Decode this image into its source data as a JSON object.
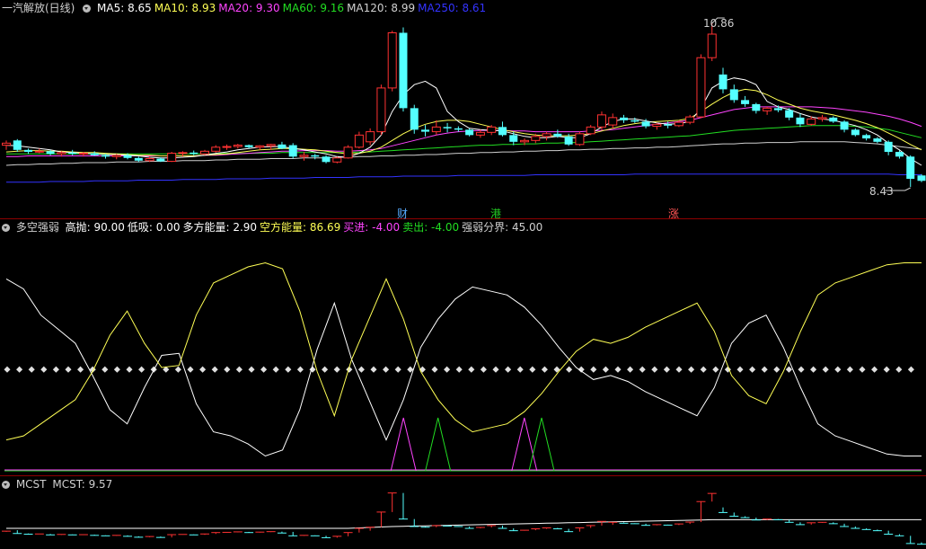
{
  "main_panel": {
    "stock_title": "一汽解放(日线)",
    "ma": [
      {
        "label": "MA5: 8.65",
        "color": "#ffffff"
      },
      {
        "label": "MA10: 8.93",
        "color": "#ffff55"
      },
      {
        "label": "MA20: 9.30",
        "color": "#ff44ff"
      },
      {
        "label": "MA60: 9.16",
        "color": "#22dd22"
      },
      {
        "label": "MA120: 8.99",
        "color": "#d0d0d0"
      },
      {
        "label": "MA250: 8.61",
        "color": "#3333ff"
      }
    ],
    "high_label": "10.86",
    "low_label": "8.43",
    "event_tags": [
      {
        "text": "财",
        "color": "#55aaff"
      },
      {
        "text": "港",
        "color": "#22cc22"
      },
      {
        "text": "涨",
        "color": "#ff5555"
      }
    ]
  },
  "indicator_panel": {
    "name": "多空强弱",
    "items": [
      {
        "label": "高抛: 90.00",
        "color": "#ffffff"
      },
      {
        "label": "低吸: 0.00",
        "color": "#ffffff"
      },
      {
        "label": "多方能量: 2.90",
        "color": "#ffffff"
      },
      {
        "label": "空方能量: 86.69",
        "color": "#ffff55"
      },
      {
        "label": "买进: -4.00",
        "color": "#ff44ff"
      },
      {
        "label": "卖出: -4.00",
        "color": "#22dd22"
      },
      {
        "label": "强弱分界: 45.00",
        "color": "#d0d0d0"
      }
    ]
  },
  "mcst_panel": {
    "name": "MCST",
    "value_label": "MCST: 9.57"
  },
  "chart_data": {
    "type": "candlestick",
    "price_range": [
      8.43,
      10.86
    ],
    "ohlc": [
      [
        9.05,
        9.12,
        8.98,
        9.08
      ],
      [
        9.12,
        9.14,
        8.95,
        8.98
      ],
      [
        8.98,
        9.0,
        8.92,
        8.95
      ],
      [
        8.95,
        9.0,
        8.93,
        8.96
      ],
      [
        8.96,
        8.98,
        8.9,
        8.92
      ],
      [
        8.92,
        8.96,
        8.88,
        8.94
      ],
      [
        8.94,
        8.98,
        8.9,
        8.92
      ],
      [
        8.92,
        8.95,
        8.88,
        8.93
      ],
      [
        8.93,
        8.96,
        8.89,
        8.9
      ],
      [
        8.9,
        8.92,
        8.85,
        8.88
      ],
      [
        8.88,
        8.92,
        8.84,
        8.9
      ],
      [
        8.9,
        8.93,
        8.84,
        8.86
      ],
      [
        8.86,
        8.88,
        8.8,
        8.82
      ],
      [
        8.82,
        8.88,
        8.8,
        8.85
      ],
      [
        8.85,
        8.87,
        8.8,
        8.81
      ],
      [
        8.81,
        8.95,
        8.8,
        8.93
      ],
      [
        8.93,
        8.96,
        8.88,
        8.94
      ],
      [
        8.94,
        8.97,
        8.9,
        8.92
      ],
      [
        8.92,
        8.98,
        8.9,
        8.96
      ],
      [
        8.96,
        9.05,
        8.94,
        9.02
      ],
      [
        9.02,
        9.06,
        8.98,
        9.03
      ],
      [
        9.03,
        9.07,
        9.0,
        9.05
      ],
      [
        9.05,
        9.06,
        9.0,
        9.02
      ],
      [
        9.02,
        9.05,
        8.98,
        9.04
      ],
      [
        9.04,
        9.07,
        8.98,
        9.06
      ],
      [
        9.06,
        9.1,
        8.99,
        9.0
      ],
      [
        9.05,
        9.08,
        8.85,
        8.88
      ],
      [
        8.88,
        8.95,
        8.82,
        8.9
      ],
      [
        8.9,
        8.92,
        8.84,
        8.88
      ],
      [
        8.88,
        8.9,
        8.78,
        8.8
      ],
      [
        8.8,
        8.88,
        8.78,
        8.86
      ],
      [
        8.86,
        9.05,
        8.85,
        9.02
      ],
      [
        9.02,
        9.25,
        9.0,
        9.2
      ],
      [
        9.1,
        9.3,
        9.05,
        9.25
      ],
      [
        9.25,
        9.95,
        9.2,
        9.9
      ],
      [
        9.9,
        10.75,
        9.85,
        10.72
      ],
      [
        10.72,
        10.8,
        9.55,
        9.6
      ],
      [
        9.6,
        9.65,
        9.22,
        9.28
      ],
      [
        9.28,
        9.35,
        9.18,
        9.25
      ],
      [
        9.25,
        9.42,
        9.2,
        9.32
      ],
      [
        9.32,
        9.38,
        9.24,
        9.3
      ],
      [
        9.3,
        9.33,
        9.25,
        9.28
      ],
      [
        9.28,
        9.3,
        9.18,
        9.2
      ],
      [
        9.2,
        9.28,
        9.16,
        9.24
      ],
      [
        9.24,
        9.35,
        9.2,
        9.32
      ],
      [
        9.32,
        9.4,
        9.18,
        9.2
      ],
      [
        9.2,
        9.25,
        9.05,
        9.1
      ],
      [
        9.1,
        9.15,
        9.05,
        9.12
      ],
      [
        9.12,
        9.22,
        9.08,
        9.18
      ],
      [
        9.18,
        9.25,
        9.12,
        9.22
      ],
      [
        9.22,
        9.28,
        9.16,
        9.18
      ],
      [
        9.18,
        9.22,
        9.04,
        9.06
      ],
      [
        9.06,
        9.25,
        9.04,
        9.22
      ],
      [
        9.22,
        9.35,
        9.2,
        9.32
      ],
      [
        9.32,
        9.55,
        9.28,
        9.5
      ],
      [
        9.35,
        9.52,
        9.3,
        9.46
      ],
      [
        9.46,
        9.5,
        9.38,
        9.42
      ],
      [
        9.42,
        9.46,
        9.38,
        9.4
      ],
      [
        9.4,
        9.44,
        9.3,
        9.33
      ],
      [
        9.33,
        9.38,
        9.28,
        9.36
      ],
      [
        9.36,
        9.4,
        9.3,
        9.34
      ],
      [
        9.34,
        9.42,
        9.32,
        9.39
      ],
      [
        9.39,
        9.5,
        9.36,
        9.47
      ],
      [
        9.47,
        10.4,
        9.45,
        10.35
      ],
      [
        10.35,
        10.86,
        10.3,
        10.7
      ],
      [
        10.1,
        10.2,
        9.82,
        9.88
      ],
      [
        9.88,
        9.95,
        9.68,
        9.72
      ],
      [
        9.72,
        9.78,
        9.62,
        9.66
      ],
      [
        9.66,
        9.68,
        9.52,
        9.56
      ],
      [
        9.56,
        9.62,
        9.5,
        9.6
      ],
      [
        9.6,
        9.64,
        9.54,
        9.57
      ],
      [
        9.57,
        9.6,
        9.42,
        9.46
      ],
      [
        9.46,
        9.52,
        9.32,
        9.36
      ],
      [
        9.36,
        9.48,
        9.34,
        9.44
      ],
      [
        9.44,
        9.5,
        9.4,
        9.46
      ],
      [
        9.46,
        9.48,
        9.38,
        9.4
      ],
      [
        9.4,
        9.42,
        9.24,
        9.28
      ],
      [
        9.28,
        9.3,
        9.18,
        9.2
      ],
      [
        9.2,
        9.22,
        9.12,
        9.15
      ],
      [
        9.15,
        9.17,
        9.08,
        9.1
      ],
      [
        9.1,
        9.12,
        8.9,
        8.95
      ],
      [
        8.95,
        8.97,
        8.85,
        8.88
      ],
      [
        8.88,
        8.9,
        8.43,
        8.55
      ],
      [
        8.6,
        8.62,
        8.5,
        8.52
      ]
    ],
    "ma5": [
      9.05,
      9.04,
      9.02,
      9.0,
      8.98,
      8.95,
      8.94,
      8.93,
      8.92,
      8.91,
      8.91,
      8.9,
      8.89,
      8.87,
      8.86,
      8.86,
      8.87,
      8.88,
      8.9,
      8.93,
      8.95,
      8.98,
      9.0,
      9.02,
      9.03,
      9.03,
      9.0,
      8.98,
      8.95,
      8.92,
      8.88,
      8.87,
      8.93,
      9.02,
      9.2,
      9.55,
      9.8,
      9.95,
      10.0,
      9.9,
      9.55,
      9.4,
      9.3,
      9.28,
      9.27,
      9.26,
      9.22,
      9.18,
      9.16,
      9.16,
      9.18,
      9.16,
      9.16,
      9.22,
      9.32,
      9.4,
      9.44,
      9.44,
      9.41,
      9.38,
      9.36,
      9.37,
      9.4,
      9.6,
      9.9,
      10.0,
      10.05,
      10.02,
      9.95,
      9.7,
      9.62,
      9.58,
      9.52,
      9.47,
      9.44,
      9.42,
      9.38,
      9.34,
      9.28,
      9.2,
      9.08,
      8.98,
      8.85,
      8.75
    ],
    "ma10": [
      8.95,
      8.96,
      8.97,
      8.97,
      8.96,
      8.96,
      8.95,
      8.94,
      8.94,
      8.93,
      8.92,
      8.91,
      8.9,
      8.9,
      8.89,
      8.89,
      8.89,
      8.89,
      8.9,
      8.91,
      8.92,
      8.94,
      8.96,
      8.98,
      8.99,
      9.0,
      9.0,
      8.99,
      8.98,
      8.96,
      8.94,
      8.92,
      8.93,
      8.96,
      9.02,
      9.12,
      9.22,
      9.3,
      9.36,
      9.4,
      9.42,
      9.42,
      9.4,
      9.36,
      9.32,
      9.28,
      9.25,
      9.22,
      9.2,
      9.19,
      9.19,
      9.19,
      9.2,
      9.22,
      9.26,
      9.3,
      9.34,
      9.37,
      9.39,
      9.4,
      9.41,
      9.42,
      9.45,
      9.55,
      9.66,
      9.76,
      9.84,
      9.88,
      9.86,
      9.8,
      9.72,
      9.66,
      9.6,
      9.56,
      9.53,
      9.5,
      9.46,
      9.42,
      9.37,
      9.31,
      9.23,
      9.15,
      9.06,
      8.98
    ],
    "ma20": [
      8.88,
      8.88,
      8.89,
      8.89,
      8.89,
      8.89,
      8.89,
      8.89,
      8.89,
      8.89,
      8.89,
      8.89,
      8.89,
      8.89,
      8.89,
      8.89,
      8.89,
      8.89,
      8.9,
      8.9,
      8.91,
      8.92,
      8.93,
      8.94,
      8.95,
      8.96,
      8.96,
      8.97,
      8.97,
      8.97,
      8.96,
      8.96,
      8.97,
      8.98,
      9.0,
      9.04,
      9.08,
      9.12,
      9.16,
      9.2,
      9.23,
      9.25,
      9.26,
      9.27,
      9.27,
      9.27,
      9.26,
      9.26,
      9.25,
      9.25,
      9.25,
      9.25,
      9.25,
      9.26,
      9.27,
      9.28,
      9.3,
      9.32,
      9.34,
      9.36,
      9.38,
      9.4,
      9.42,
      9.46,
      9.5,
      9.54,
      9.58,
      9.6,
      9.62,
      9.62,
      9.62,
      9.62,
      9.62,
      9.62,
      9.61,
      9.6,
      9.58,
      9.56,
      9.54,
      9.51,
      9.48,
      9.44,
      9.39,
      9.33
    ],
    "ma60": [
      8.92,
      8.92,
      8.92,
      8.92,
      8.92,
      8.92,
      8.92,
      8.92,
      8.92,
      8.92,
      8.92,
      8.92,
      8.92,
      8.92,
      8.92,
      8.92,
      8.92,
      8.92,
      8.92,
      8.92,
      8.93,
      8.93,
      8.93,
      8.93,
      8.93,
      8.94,
      8.94,
      8.94,
      8.94,
      8.94,
      8.94,
      8.94,
      8.95,
      8.95,
      8.96,
      8.97,
      8.98,
      8.99,
      9.0,
      9.01,
      9.02,
      9.03,
      9.04,
      9.05,
      9.05,
      9.06,
      9.06,
      9.07,
      9.07,
      9.08,
      9.08,
      9.09,
      9.09,
      9.1,
      9.11,
      9.12,
      9.13,
      9.14,
      9.15,
      9.16,
      9.17,
      9.18,
      9.19,
      9.21,
      9.23,
      9.25,
      9.27,
      9.28,
      9.29,
      9.3,
      9.31,
      9.32,
      9.33,
      9.34,
      9.34,
      9.34,
      9.34,
      9.33,
      9.32,
      9.3,
      9.28,
      9.24,
      9.2,
      9.16
    ],
    "ma120": [
      8.75,
      8.76,
      8.76,
      8.77,
      8.77,
      8.78,
      8.78,
      8.79,
      8.79,
      8.79,
      8.8,
      8.8,
      8.8,
      8.81,
      8.81,
      8.81,
      8.82,
      8.82,
      8.82,
      8.83,
      8.83,
      8.84,
      8.84,
      8.84,
      8.85,
      8.85,
      8.85,
      8.86,
      8.86,
      8.86,
      8.87,
      8.87,
      8.88,
      8.88,
      8.89,
      8.89,
      8.9,
      8.9,
      8.91,
      8.91,
      8.92,
      8.93,
      8.93,
      8.94,
      8.94,
      8.95,
      8.95,
      8.96,
      8.96,
      8.97,
      8.97,
      8.98,
      8.98,
      8.99,
      8.99,
      9.0,
      9.0,
      9.01,
      9.01,
      9.02,
      9.02,
      9.03,
      9.04,
      9.05,
      9.06,
      9.07,
      9.07,
      9.08,
      9.08,
      9.09,
      9.09,
      9.09,
      9.1,
      9.1,
      9.1,
      9.1,
      9.1,
      9.09,
      9.08,
      9.07,
      9.05,
      9.03,
      9.01,
      8.99
    ],
    "ma250": [
      8.5,
      8.5,
      8.5,
      8.5,
      8.51,
      8.51,
      8.51,
      8.51,
      8.52,
      8.52,
      8.52,
      8.52,
      8.53,
      8.53,
      8.53,
      8.53,
      8.54,
      8.54,
      8.54,
      8.54,
      8.55,
      8.55,
      8.55,
      8.55,
      8.56,
      8.56,
      8.56,
      8.56,
      8.57,
      8.57,
      8.57,
      8.57,
      8.58,
      8.58,
      8.58,
      8.58,
      8.59,
      8.59,
      8.59,
      8.59,
      8.59,
      8.6,
      8.6,
      8.6,
      8.6,
      8.6,
      8.6,
      8.6,
      8.61,
      8.61,
      8.61,
      8.61,
      8.61,
      8.61,
      8.61,
      8.61,
      8.61,
      8.62,
      8.62,
      8.62,
      8.62,
      8.62,
      8.62,
      8.62,
      8.62,
      8.62,
      8.62,
      8.62,
      8.62,
      8.62,
      8.62,
      8.62,
      8.62,
      8.62,
      8.62,
      8.62,
      8.62,
      8.62,
      8.62,
      8.62,
      8.62,
      8.61,
      8.61,
      8.61
    ],
    "indicator": {
      "range": [
        0,
        100
      ],
      "long_energy": [
        90,
        85,
        72,
        65,
        58,
        42,
        25,
        18,
        36,
        52,
        53,
        28,
        14,
        12,
        8,
        2,
        5,
        25,
        55,
        78,
        50,
        30,
        10,
        30,
        56,
        70,
        80,
        86,
        84,
        82,
        76,
        67,
        56,
        46,
        40,
        42,
        39,
        34,
        30,
        26,
        22,
        36,
        58,
        68,
        72,
        56,
        36,
        18,
        12,
        9,
        6,
        3,
        2,
        2
      ],
      "short_energy": [
        10,
        12,
        18,
        24,
        30,
        44,
        62,
        74,
        58,
        46,
        47,
        72,
        88,
        92,
        96,
        98,
        95,
        74,
        44,
        22,
        50,
        70,
        90,
        70,
        44,
        30,
        20,
        14,
        16,
        18,
        24,
        33,
        44,
        54,
        60,
        58,
        61,
        66,
        70,
        74,
        78,
        64,
        42,
        32,
        28,
        44,
        64,
        82,
        88,
        91,
        94,
        97,
        98,
        98
      ],
      "boundary": 45,
      "buy_spikes": [
        23,
        30
      ],
      "sell_spikes": [
        25,
        31
      ]
    },
    "mcst": {
      "range": [
        8.43,
        10.86
      ],
      "line": [
        9.2,
        9.2,
        9.2,
        9.2,
        9.2,
        9.2,
        9.2,
        9.2,
        9.2,
        9.2,
        9.2,
        9.2,
        9.2,
        9.2,
        9.2,
        9.2,
        9.2,
        9.2,
        9.2,
        9.2,
        9.2,
        9.2,
        9.2,
        9.2,
        9.2,
        9.2,
        9.2,
        9.2,
        9.2,
        9.2,
        9.2,
        9.2,
        9.22,
        9.24,
        9.26,
        9.28,
        9.29,
        9.3,
        9.31,
        9.32,
        9.33,
        9.34,
        9.35,
        9.36,
        9.37,
        9.38,
        9.39,
        9.4,
        9.41,
        9.42,
        9.43,
        9.44,
        9.45,
        9.46,
        9.47,
        9.48,
        9.49,
        9.5,
        9.51,
        9.52,
        9.53,
        9.54,
        9.55,
        9.56,
        9.57,
        9.57,
        9.57,
        9.57,
        9.57,
        9.57,
        9.57,
        9.57,
        9.57,
        9.57,
        9.57,
        9.57,
        9.57,
        9.57,
        9.57,
        9.57,
        9.57,
        9.57,
        9.57,
        9.57
      ]
    }
  }
}
